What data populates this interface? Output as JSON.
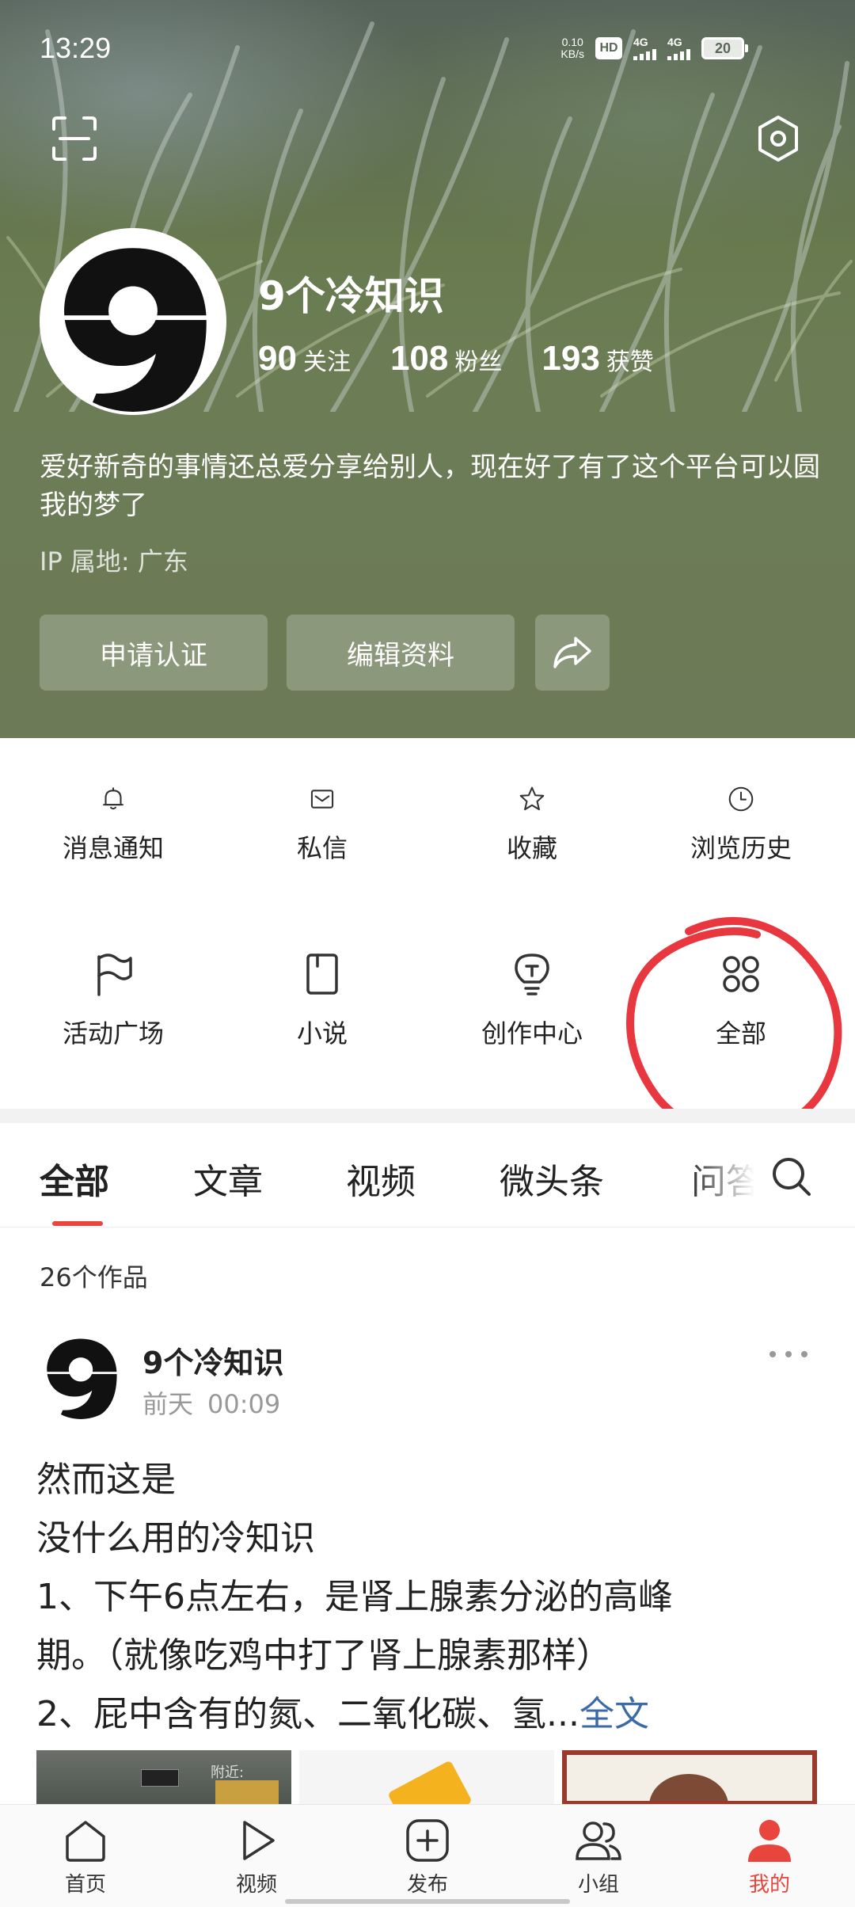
{
  "status_bar": {
    "time": "13:29",
    "net_speed_value": "0.10",
    "net_speed_unit": "KB/s",
    "hd_label": "HD",
    "network_1": "4G",
    "network_2": "4G",
    "battery_level": "20"
  },
  "header": {
    "scan_icon": "scan-icon",
    "settings_icon": "settings-hexagon-icon",
    "username": "9个冷知识",
    "stats": [
      {
        "value": "90",
        "label": "关注"
      },
      {
        "value": "108",
        "label": "粉丝"
      },
      {
        "value": "193",
        "label": "获赞"
      }
    ],
    "bio": "爱好新奇的事情还总爱分享给别人，现在好了有了这个平台可以圆我的梦了",
    "ip_location": "IP 属地: 广东",
    "buttons": {
      "verify": "申请认证",
      "edit_profile": "编辑资料",
      "share_icon": "share-icon"
    }
  },
  "quick_menu": {
    "items": [
      {
        "label": "消息通知",
        "icon": "bell-icon"
      },
      {
        "label": "私信",
        "icon": "mail-icon"
      },
      {
        "label": "收藏",
        "icon": "star-icon"
      },
      {
        "label": "浏览历史",
        "icon": "clock-icon"
      },
      {
        "label": "活动广场",
        "icon": "flag-icon"
      },
      {
        "label": "小说",
        "icon": "book-icon"
      },
      {
        "label": "创作中心",
        "icon": "lightbulb-icon"
      },
      {
        "label": "全部",
        "icon": "grid-dots-icon"
      }
    ],
    "highlight_color": "#e8373f"
  },
  "content_tabs": {
    "tabs": [
      "全部",
      "文章",
      "视频",
      "微头条",
      "问答"
    ],
    "active_index": 0,
    "accent_color": "#e8453c"
  },
  "feed": {
    "works_count": "26个作品",
    "post": {
      "author": "9个冷知识",
      "date": "前天",
      "time": "00:09",
      "lines": [
        "然而这是",
        "没什么用的冷知识",
        "1、下午6点左右，是肾上腺素分泌的高峰",
        "期。（就像吃鸡中打了肾上腺素那样）",
        "2、屁中含有的氮、二氧化碳、氢..."
      ],
      "full_text_link": "全文",
      "thumb_text": "附近:"
    }
  },
  "bottom_nav": {
    "items": [
      {
        "label": "首页",
        "icon": "home-icon"
      },
      {
        "label": "视频",
        "icon": "play-icon"
      },
      {
        "label": "发布",
        "icon": "plus-square-icon"
      },
      {
        "label": "小组",
        "icon": "group-icon"
      },
      {
        "label": "我的",
        "icon": "user-icon"
      }
    ],
    "active_index": 4
  }
}
